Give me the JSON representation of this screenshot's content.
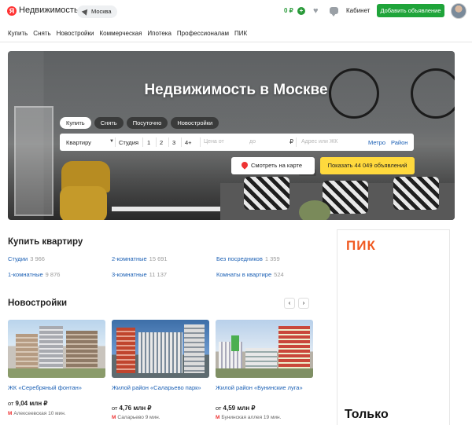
{
  "header": {
    "logo_letter": "Я",
    "logo_text": "Недвижимость",
    "city": "Москва",
    "balance": "0 ₽",
    "balance_plus": "+",
    "cabinet": "Кабинет",
    "add_button": "Добавить объявление"
  },
  "nav": [
    "Купить",
    "Снять",
    "Новостройки",
    "Коммерческая",
    "Ипотека",
    "Профессионалам",
    "ПИК"
  ],
  "hero": {
    "title": "Недвижимость в Москве",
    "tabs": [
      "Купить",
      "Снять",
      "Посуточно",
      "Новостройки"
    ],
    "active_tab": "Купить",
    "search": {
      "type": "Квартиру",
      "type_chevron": "▼",
      "rooms": [
        "Студия",
        "1",
        "2",
        "3",
        "4+"
      ],
      "price_from": "Цена от",
      "price_to": "до",
      "currency": "₽",
      "address_placeholder": "Адрес или ЖК",
      "metro": "Метро",
      "district": "Район"
    },
    "map_button": "Смотреть на карте",
    "show_button": "Показать 44 049 объявлений"
  },
  "buy": {
    "title": "Купить квартиру",
    "links": [
      {
        "label": "Студии",
        "count": "3 966"
      },
      {
        "label": "2-комнатные",
        "count": "15 691"
      },
      {
        "label": "Без посредников",
        "count": "1 359"
      },
      {
        "label": "1-комнатные",
        "count": "9 876"
      },
      {
        "label": "3-комнатные",
        "count": "11 137"
      },
      {
        "label": "Комнаты в квартире",
        "count": "524"
      }
    ]
  },
  "new_buildings": {
    "title": "Новостройки",
    "prev": "‹",
    "next": "›",
    "cards": [
      {
        "title": "ЖК «Серебряный фонтан»",
        "price_prefix": "от",
        "price": "9,04 млн ₽",
        "metro": "Алексеевская 10 мин."
      },
      {
        "title": "Жилой район «Саларьево парк»",
        "price_prefix": "от",
        "price": "4,76 млн ₽",
        "metro": "Саларьево 9 мин."
      },
      {
        "title": "Жилой район «Бунинские луга»",
        "price_prefix": "от",
        "price": "4,59 млн ₽",
        "metro": "Бунинская аллея 19 мин."
      }
    ]
  },
  "ad": {
    "logo": "ПИК",
    "text": "Только"
  },
  "colors": {
    "accent_green": "#1fa43a",
    "link_blue": "#1a5fb4",
    "show_yellow": "#ffd93d",
    "pik_orange": "#f05a22"
  }
}
